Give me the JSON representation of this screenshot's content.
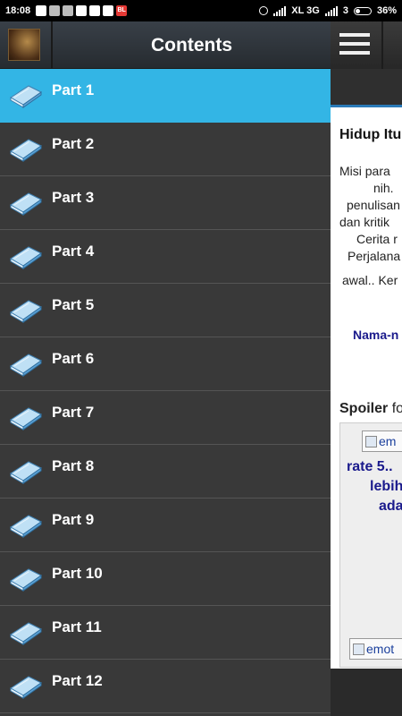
{
  "status_bar": {
    "time": "18:08",
    "network": "XL 3G",
    "sim2": "3",
    "battery": "36%",
    "battery_level": 0.36,
    "notification_icons": [
      "whatsapp-icon",
      "message-icon",
      "message-icon",
      "chrome-icon",
      "whatsapp-icon",
      "whatsapp-icon",
      "bl-app-icon"
    ],
    "bl_label": "BL"
  },
  "drawer": {
    "title": "Contents",
    "active_index": 0,
    "accent": "#33b5e5",
    "items": [
      {
        "label": "Part 1"
      },
      {
        "label": "Part 2"
      },
      {
        "label": "Part 3"
      },
      {
        "label": "Part 4"
      },
      {
        "label": "Part 5"
      },
      {
        "label": "Part 6"
      },
      {
        "label": "Part 7"
      },
      {
        "label": "Part 8"
      },
      {
        "label": "Part 9"
      },
      {
        "label": "Part 10"
      },
      {
        "label": "Part 11"
      },
      {
        "label": "Part 12"
      }
    ]
  },
  "content": {
    "title": "Hidup Itu",
    "lines": [
      "Misi para",
      "nih.",
      "penulisan",
      "dan kritik",
      "Cerita r",
      "Perjalana",
      "awal.. Ker"
    ],
    "link": "Nama-n",
    "spoiler_label": "Spoiler",
    "spoiler_suffix": "fo",
    "spoiler_lines": [
      "rate 5..",
      "lebih",
      "ada"
    ],
    "img_alt_1": "em",
    "img_alt_2": "emot"
  }
}
